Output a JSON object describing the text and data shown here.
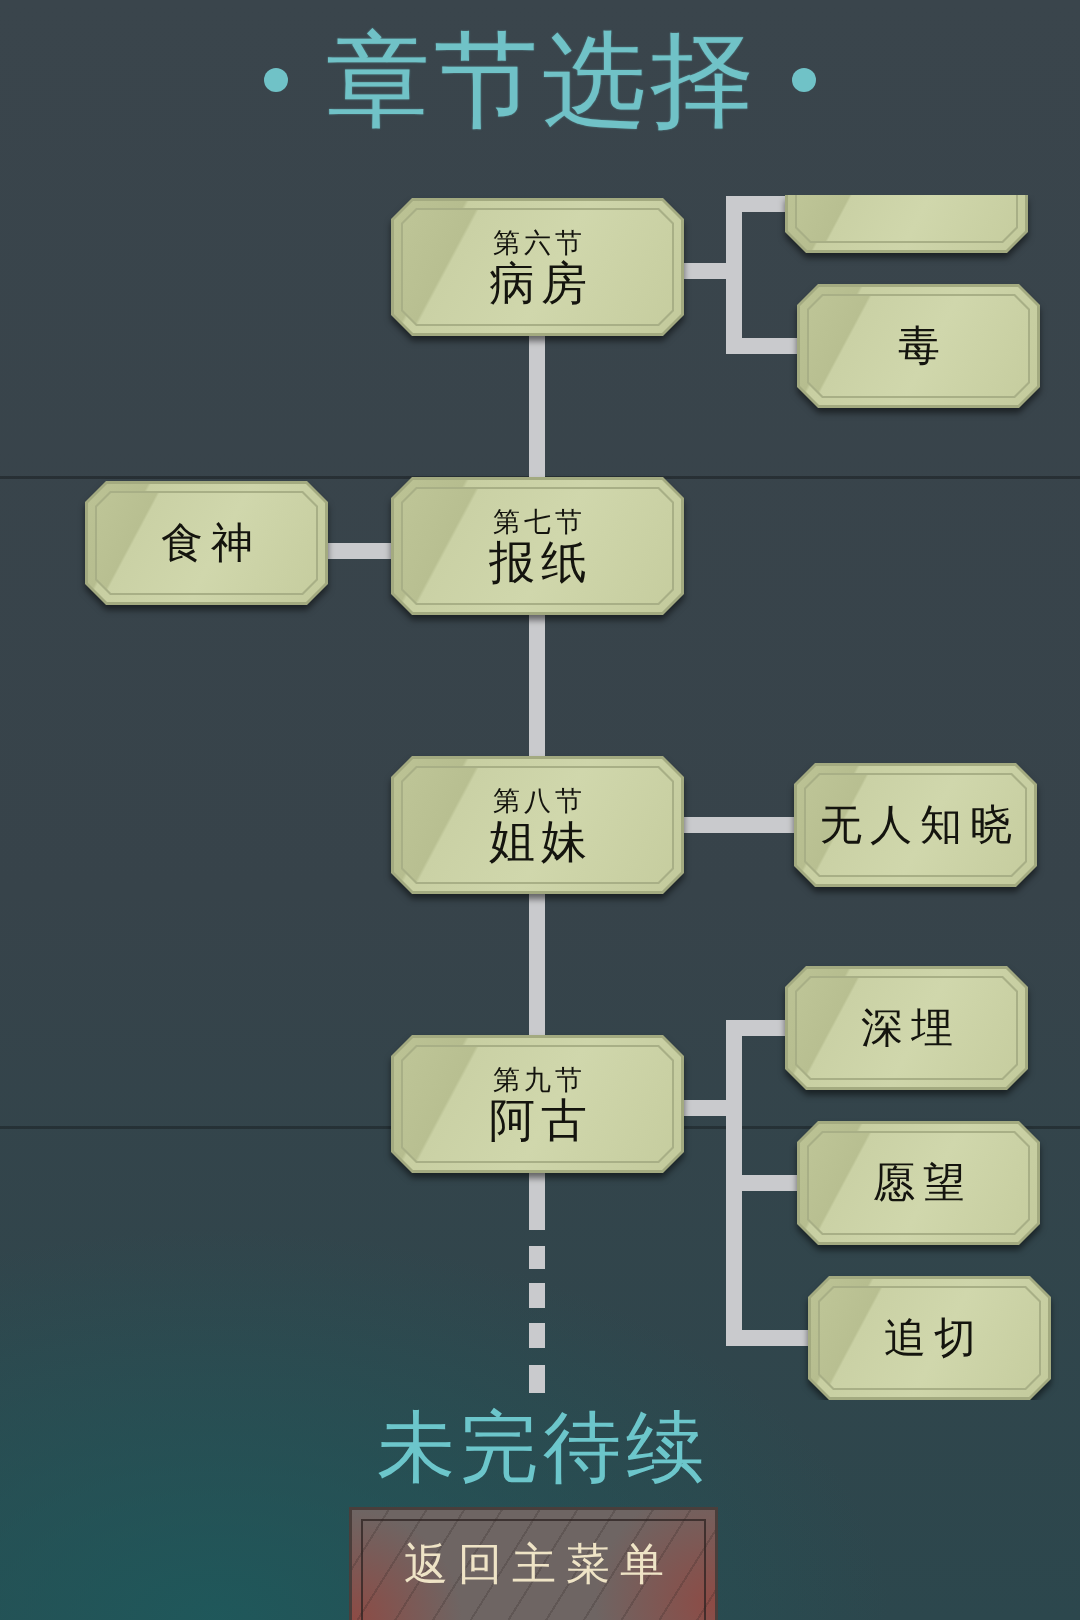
{
  "title": "章节选择",
  "tree": {
    "unfinished": true,
    "chapters": [
      {
        "number": "第六节",
        "name": "病房",
        "right_branches": [
          {
            "kind": "cut"
          },
          {
            "kind": "full",
            "label": "毒"
          }
        ]
      },
      {
        "number": "第七节",
        "name": "报纸",
        "left_branches": [
          {
            "kind": "full",
            "label": "食神"
          }
        ]
      },
      {
        "number": "第八节",
        "name": "姐妹",
        "right_branches": [
          {
            "kind": "full",
            "label": "无人知晓"
          }
        ]
      },
      {
        "number": "第九节",
        "name": "阿古",
        "right_branches": [
          {
            "kind": "full",
            "label": "深埋"
          },
          {
            "kind": "full",
            "label": "愿望"
          },
          {
            "kind": "full",
            "label": "追切"
          }
        ]
      }
    ]
  },
  "footer": "未完待续",
  "back_button": {
    "label": "返回主菜单"
  }
}
